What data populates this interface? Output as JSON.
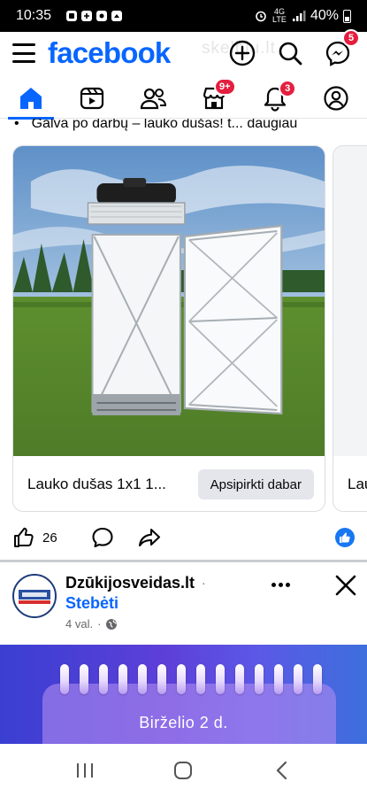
{
  "status_bar": {
    "time": "10:35",
    "network": "4G LTE",
    "battery": "40%"
  },
  "header": {
    "brand": "facebook",
    "watermark": "skelbiu.lt",
    "messenger_badge": "5"
  },
  "tabs": {
    "marketplace_badge": "9+",
    "notifications_badge": "3"
  },
  "previous_post": {
    "bullet": "•",
    "caption": "Galva po darbų – lauko dušas! t... daugiau"
  },
  "carousel": {
    "cards": [
      {
        "title": "Lauko dušas 1x1 1...",
        "cta": "Apsipirkti dabar"
      },
      {
        "title": "Lau"
      }
    ]
  },
  "reactions": {
    "like_count": "26"
  },
  "next_post": {
    "page_name": "Dzūkijosveidas.lt",
    "separator": "·",
    "follow": "Stebėti",
    "time": "4 val.",
    "meta_separator": "·"
  },
  "banner": {
    "text": "Birželio 2 d."
  },
  "colors": {
    "brand_blue": "#0866ff",
    "badge_red": "#e41e3f",
    "banner_purple": "#5d3fd8"
  },
  "icons": [
    "hamburger-icon",
    "plus-icon",
    "search-icon",
    "messenger-icon",
    "home-icon",
    "video-icon",
    "friends-icon",
    "marketplace-icon",
    "bell-icon",
    "profile-icon",
    "like-icon",
    "comment-icon",
    "share-icon",
    "more-icon",
    "close-icon",
    "globe-icon",
    "recents-icon",
    "home-circle-icon",
    "back-icon"
  ]
}
